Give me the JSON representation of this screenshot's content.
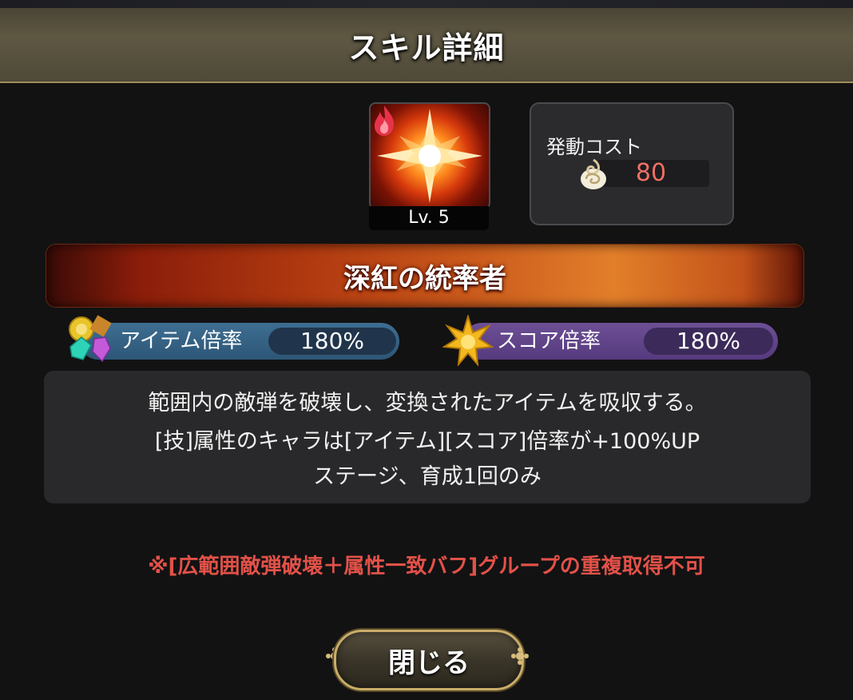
{
  "dialog": {
    "title": "スキル詳細"
  },
  "skill": {
    "icon": "burst-star-icon",
    "element_icon": "fire-icon",
    "level_label": "Lv. 5",
    "name": "深紅の統率者"
  },
  "cost": {
    "label": "発動コスト",
    "icon": "spiral-energy-icon",
    "value": "80",
    "value_color": "#f07063"
  },
  "multipliers": {
    "item": {
      "icon": "gems-icon",
      "label": "アイテム倍率",
      "value": "180%"
    },
    "score": {
      "icon": "gold-star-icon",
      "label": "スコア倍率",
      "value": "180%"
    }
  },
  "description": {
    "lines": [
      "範囲内の敵弾を破壊し、変換されたアイテムを吸収する。",
      "[技]属性のキャラは[アイテム][スコア]倍率が+100%UP",
      "ステージ、育成1回のみ"
    ]
  },
  "note": {
    "text": "※[広範囲敵弾破壊＋属性一致バフ]グループの重複取得不可",
    "color": "#e25148"
  },
  "close_button": {
    "label": "閉じる"
  }
}
